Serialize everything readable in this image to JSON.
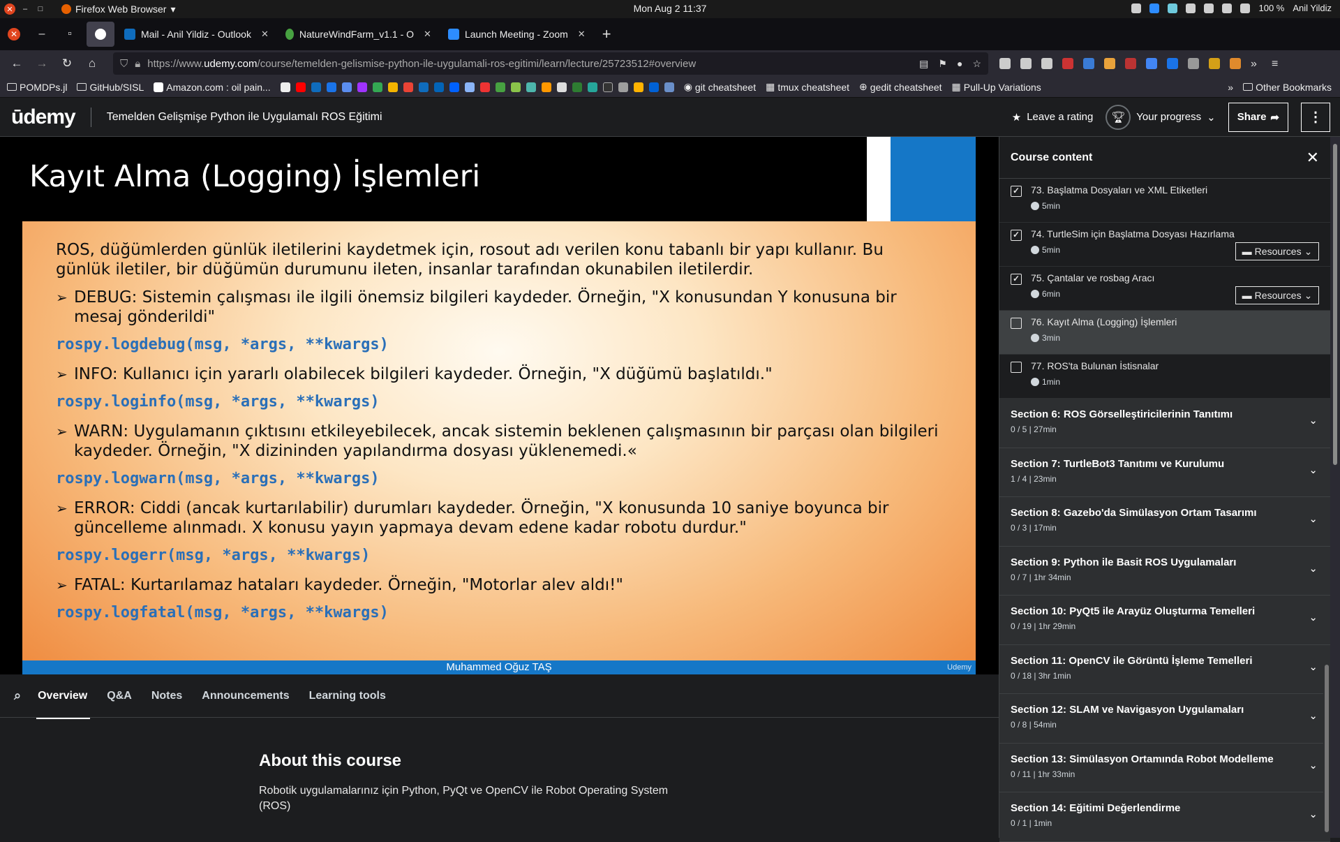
{
  "topbar": {
    "app_name": "Firefox Web Browser",
    "clock": "Mon Aug 2  11:37",
    "battery": "100 %",
    "user": "Anil Yildiz"
  },
  "tabs": [
    {
      "label": "Mail - Anil Yildiz - Outlook",
      "icon": "outlook-icon",
      "color": "#0f6cbd"
    },
    {
      "label": "NatureWindFarm_v1.1 - O",
      "icon": "overleaf-icon",
      "color": "#47a141"
    },
    {
      "label": "Launch Meeting - Zoom",
      "icon": "zoom-icon",
      "color": "#2d8cff"
    }
  ],
  "url": {
    "prefix": "https://www.",
    "host": "udemy.com",
    "path": "/course/temelden-gelismise-python-ile-uygulamali-ros-egitimi/learn/lecture/25723512#overview"
  },
  "bookmarks": {
    "left": [
      "POMDPs.jl",
      "GitHub/SISL",
      "Amazon.com : oil pain..."
    ],
    "right_text": [
      "git cheatsheet",
      "tmux cheatsheet",
      "gedit cheatsheet",
      "Pull-Up Variations"
    ],
    "other": "Other Bookmarks"
  },
  "header": {
    "logo": "ūdemy",
    "course_title": "Temelden Gelişmişe Python ile Uygulamalı ROS Eğitimi",
    "leave_rating": "Leave a rating",
    "your_progress": "Your progress",
    "share": "Share"
  },
  "slide": {
    "title": "Kayıt Alma (Logging) İşlemleri",
    "intro": "ROS, düğümlerden günlük iletilerini kaydetmek için, rosout adı verilen konu tabanlı bir yapı kullanır. Bu günlük iletiler, bir düğümün durumunu ileten, insanlar tarafından okunabilen iletilerdir.",
    "items": [
      {
        "text": "DEBUG: Sistemin çalışması ile ilgili önemsiz bilgileri kaydeder. Örneğin, \"X konusundan Y konusuna bir mesaj gönderildi\"",
        "code": "rospy.logdebug(msg, *args, **kwargs)"
      },
      {
        "text": "INFO: Kullanıcı için yararlı olabilecek bilgileri kaydeder. Örneğin, \"X düğümü başlatıldı.\"",
        "code": "rospy.loginfo(msg, *args, **kwargs)"
      },
      {
        "text": "WARN: Uygulamanın çıktısını etkileyebilecek, ancak sistemin beklenen çalışmasının bir parçası olan bilgileri kaydeder. Örneğin, \"X dizininden yapılandırma dosyası yüklenemedi.«",
        "code": "rospy.logwarn(msg, *args, **kwargs)"
      },
      {
        "text": "ERROR: Ciddi (ancak kurtarılabilir) durumları kaydeder. Örneğin, \"X konusunda 10 saniye boyunca bir güncelleme alınmadı. X konusu yayın yapmaya devam edene kadar robotu durdur.\"",
        "code": "rospy.logerr(msg, *args, **kwargs)"
      },
      {
        "text": "FATAL: Kurtarılamaz hataları kaydeder. Örneğin, \"Motorlar alev aldı!\"",
        "code": "rospy.logfatal(msg, *args, **kwargs)"
      }
    ],
    "footer": "Muhammed Oğuz TAŞ",
    "watermark": "Udemy"
  },
  "lower_tabs": [
    "Overview",
    "Q&A",
    "Notes",
    "Announcements",
    "Learning tools"
  ],
  "about": {
    "heading": "About this course",
    "text": "Robotik uygulamalarınız için Python, PyQt ve OpenCV ile Robot Operating System (ROS)"
  },
  "sidebar": {
    "title": "Course content",
    "lectures": [
      {
        "title": "73. Başlatma Dosyaları ve XML Etiketleri",
        "duration": "5min",
        "checked": true,
        "resources": false
      },
      {
        "title": "74. TurtleSim için Başlatma Dosyası Hazırlama",
        "duration": "5min",
        "checked": true,
        "resources": true
      },
      {
        "title": "75. Çantalar ve rosbag Aracı",
        "duration": "6min",
        "checked": true,
        "resources": true
      },
      {
        "title": "76. Kayıt Alma (Logging) İşlemleri",
        "duration": "3min",
        "checked": false,
        "resources": false,
        "current": true
      },
      {
        "title": "77. ROS'ta Bulunan İstisnalar",
        "duration": "1min",
        "checked": false,
        "resources": false
      }
    ],
    "resources_label": "Resources",
    "sections": [
      {
        "title": "Section 6: ROS Görselleştiricilerinin Tanıtımı",
        "meta": "0 / 5 | 27min"
      },
      {
        "title": "Section 7: TurtleBot3 Tanıtımı ve Kurulumu",
        "meta": "1 / 4 | 23min"
      },
      {
        "title": "Section 8: Gazebo'da Simülasyon Ortam Tasarımı",
        "meta": "0 / 3 | 17min"
      },
      {
        "title": "Section 9: Python ile Basit ROS Uygulamaları",
        "meta": "0 / 7 | 1hr 34min"
      },
      {
        "title": "Section 10: PyQt5 ile Arayüz Oluşturma Temelleri",
        "meta": "0 / 19 | 1hr 29min"
      },
      {
        "title": "Section 11: OpenCV ile Görüntü İşleme Temelleri",
        "meta": "0 / 18 | 3hr 1min"
      },
      {
        "title": "Section 12: SLAM ve Navigasyon Uygulamaları",
        "meta": "0 / 8 | 54min"
      },
      {
        "title": "Section 13: Simülasyon Ortamında Robot Modelleme",
        "meta": "0 / 11 | 1hr 33min"
      },
      {
        "title": "Section 14: Eğitimi Değerlendirme",
        "meta": "0 / 1 | 1min"
      }
    ]
  }
}
